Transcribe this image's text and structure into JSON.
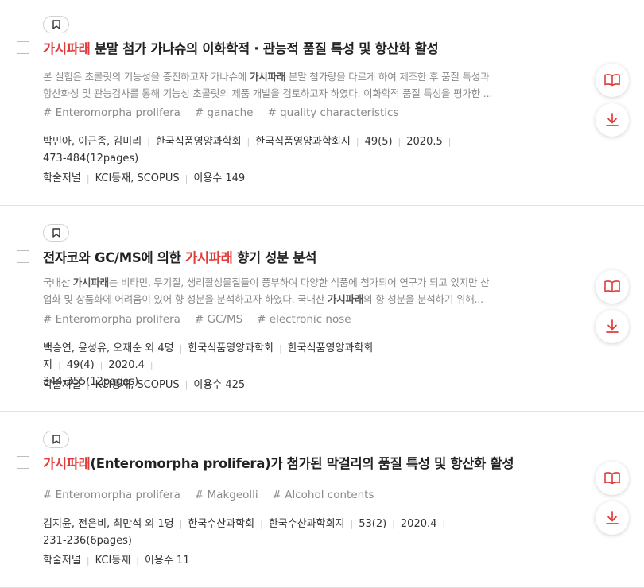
{
  "results": [
    {
      "title_hl": "가시파래",
      "title_rest": " 분말 첨가 가나슈의 이화학적 · 관능적 품질 특성 및 항산화 활성",
      "abstract_line1_a": "본 실험은 초콜릿의 기능성을 증진하고자 가나슈에 ",
      "abstract_line1_b": "가시파래",
      "abstract_line1_c": " 분말 첨가량을 다르게 하여 제조한 후 품질 특성과",
      "abstract_line2": "항산화성 및 관능검사를 통해 기능성 초콜릿의 제품 개발을 검토하고자 하였다. 이화학적 품질 특성을 평가한 ...",
      "keywords": [
        "# Enteromorpha prolifera",
        "# ganache",
        "# quality characteristics"
      ],
      "authors": "박민아, 이근종, 김미리",
      "publisher": "한국식품영양과학회",
      "journal": "한국식품영양과학회지",
      "volume": "49(5)",
      "date": "2020.5",
      "pages": "473-484(12pages)",
      "type": "학술저널",
      "index": "KCI등재, SCOPUS",
      "usage": "이용수 149"
    },
    {
      "title_a": "전자코와 GC/MS에 의한 ",
      "title_hl": "가시파래",
      "title_rest": " 향기 성분 분석",
      "abstract_line1_a": "국내산 ",
      "abstract_line1_b": "가시파래",
      "abstract_line1_c": "는 비타민, 무기질, 생리활성물질들이 풍부하여 다양한 식품에 첨가되어 연구가 되고 있지만 산",
      "abstract_line2_a": "업화 및 상품화에 어려움이 있어 향 성분을 분석하고자 하였다. 국내산 ",
      "abstract_line2_b": "가시파래",
      "abstract_line2_c": "의 향 성분을 분석하기 위해...",
      "keywords": [
        "# Enteromorpha prolifera",
        "# GC/MS",
        "# electronic nose"
      ],
      "authors": "백승연, 윤성유, 오재순 외 4명",
      "publisher": "한국식품영양과학회",
      "journal": "한국식품영양과학회지",
      "volume": "49(4)",
      "date": "2020.4",
      "pages": "344-355(12pages)",
      "type": "학술저널",
      "index": "KCI등재, SCOPUS",
      "usage": "이용수 425"
    },
    {
      "title_hl": "가시파래",
      "title_rest": "(Enteromorpha prolifera)가 첨가된 막걸리의 품질 특성 및 항산화 활성",
      "keywords": [
        "# Enteromorpha prolifera",
        "# Makgeolli",
        "# Alcohol contents"
      ],
      "authors": "김지윤, 전은비, 최만석 외 1명",
      "publisher": "한국수산과학회",
      "journal": "한국수산과학회지",
      "volume": "53(2)",
      "date": "2020.4",
      "pages": "231-236(6pages)",
      "type": "학술저널",
      "index": "KCI등재",
      "usage": "이용수 11"
    }
  ],
  "icons": {
    "bookmark": "bookmark-icon",
    "read": "open-book-icon",
    "download": "download-icon"
  },
  "colors": {
    "highlight": "#e03c3c",
    "icon": "#e03c3c"
  }
}
